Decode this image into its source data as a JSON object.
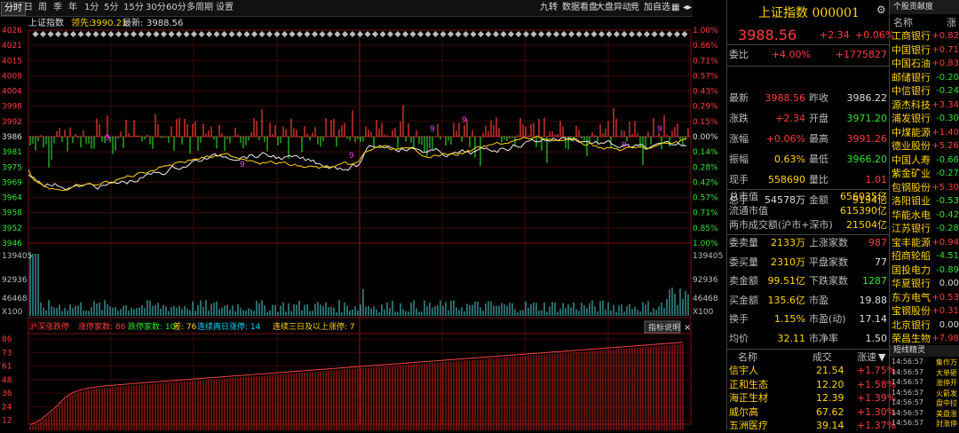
{
  "toolbar": {
    "tabs": [
      "分时",
      "日",
      "周",
      "季",
      "年",
      "1分",
      "5分",
      "15分",
      "30分",
      "60分",
      "多周期",
      "设置"
    ],
    "right_tabs": [
      "九转",
      "数据看盘",
      "大盘异动",
      "竞",
      "加自选"
    ]
  },
  "chart": {
    "index_name": "上证指数",
    "leading_label": "领先:",
    "leading_value": "3990.21",
    "latest_label": "最新:",
    "latest_value": "3988.56",
    "price_ticks": [
      "4026",
      "4021",
      "4015",
      "4009",
      "4004",
      "3998",
      "3992",
      "3986",
      "3981",
      "3975",
      "3969",
      "3964",
      "3958",
      "3952",
      "3946"
    ],
    "pct_ticks": [
      "1.00%",
      "0.86%",
      "0.71%",
      "0.57%",
      "0.43%",
      "0.29%",
      "0.15%",
      "0.00%",
      "0.14%",
      "0.28%",
      "0.42%",
      "0.57%",
      "0.71%",
      "0.85%",
      "1.00%"
    ],
    "vol_ticks": [
      "139405",
      "92936",
      "46468",
      "X100"
    ],
    "breadth_bar": {
      "a": "沪深涨跌停",
      "b": "涨停家数: 86",
      "c": "跌停家数: 10",
      "d": "差: 76",
      "e": "连续两日涨停: 14",
      "f": "连续三日及以上涨停: 7",
      "btn": "指标说明"
    },
    "breadth_ticks": [
      "86",
      "73",
      "61",
      "48",
      "36",
      "24",
      "12"
    ],
    "markers": [
      "9",
      "9",
      "9",
      "9",
      "9",
      "9",
      "9"
    ]
  },
  "panel": {
    "title": "上证指数 000001",
    "price": "3988.56",
    "change": "+2.34",
    "change_pct": "+0.06%",
    "webi_label": "委比",
    "webi_pct": "+4.00%",
    "webi_diff": "+1775827",
    "stats": [
      {
        "l1": "最新",
        "v1": "3988.56",
        "c1": "r",
        "l2": "昨收",
        "v2": "3986.22",
        "c2": "w"
      },
      {
        "l1": "涨跌",
        "v1": "+2.34",
        "c1": "r",
        "l2": "开盘",
        "v2": "3971.20",
        "c2": "g"
      },
      {
        "l1": "涨幅",
        "v1": "+0.06%",
        "c1": "r",
        "l2": "最高",
        "v2": "3991.26",
        "c2": "r"
      },
      {
        "l1": "振幅",
        "v1": "0.63%",
        "c1": "y",
        "l2": "最低",
        "v2": "3966.20",
        "c2": "g"
      },
      {
        "l1": "现手",
        "v1": "558690",
        "c1": "y",
        "l2": "量比",
        "v2": "1.01",
        "c2": "r"
      },
      {
        "l1": "总手",
        "v1": "54578万",
        "c1": "w",
        "l2": "金额",
        "v2": "9194亿",
        "c2": "y"
      }
    ],
    "market": [
      {
        "l": "总市值",
        "v": "656035亿"
      },
      {
        "l": "流通市值",
        "v": "615390亿"
      },
      {
        "l": "两市成交额(沪市+深市)",
        "v": "21504亿"
      }
    ],
    "stats2": [
      {
        "l1": "委卖量",
        "v1": "2133万",
        "c1": "y",
        "l2": "上涨家数",
        "v2": "987",
        "c2": "r"
      },
      {
        "l1": "委买量",
        "v1": "2310万",
        "c1": "y",
        "l2": "平盘家数",
        "v2": "77",
        "c2": "w"
      },
      {
        "l1": "卖金额",
        "v1": "99.51亿",
        "c1": "y",
        "l2": "下跌家数",
        "v2": "1287",
        "c2": "g"
      },
      {
        "l1": "买金额",
        "v1": "135.6亿",
        "c1": "y",
        "l2": "市盈",
        "v2": "19.88",
        "c2": "w"
      },
      {
        "l1": "换手",
        "v1": "1.15%",
        "c1": "y",
        "l2": "市盈(动)",
        "v2": "17.14",
        "c2": "w"
      },
      {
        "l1": "均价",
        "v1": "32.11",
        "c1": "y",
        "l2": "市净率",
        "v2": "1.50",
        "c2": "w"
      }
    ],
    "table_headers": [
      "名称",
      "成交",
      "涨速"
    ],
    "table": [
      {
        "name": "信宇人",
        "price": "21.54",
        "speed": "+1.75%"
      },
      {
        "name": "正和生态",
        "price": "12.20",
        "speed": "+1.58%"
      },
      {
        "name": "海正生材",
        "price": "12.39",
        "speed": "+1.39%"
      },
      {
        "name": "威尔高",
        "price": "67.62",
        "speed": "+1.30%"
      },
      {
        "name": "五洲医疗",
        "price": "39.14",
        "speed": "+1.37%"
      }
    ]
  },
  "side": {
    "header": "个股贡献度",
    "col1": "名称",
    "col2": "涨",
    "stocks": [
      {
        "n": "工商银行",
        "v": "+0.82",
        "c": "r"
      },
      {
        "n": "中国银行",
        "v": "+0.71",
        "c": "r"
      },
      {
        "n": "中国石油",
        "v": "+0.83",
        "c": "r"
      },
      {
        "n": "邮储银行",
        "v": "-0.20",
        "c": "g"
      },
      {
        "n": "中信银行",
        "v": "-0.24",
        "c": "g"
      },
      {
        "n": "源杰科技",
        "v": "+3.34",
        "c": "r"
      },
      {
        "n": "浦发银行",
        "v": "-0.30",
        "c": "g"
      },
      {
        "n": "中煤能源",
        "v": "+1.40",
        "c": "r"
      },
      {
        "n": "德业股份",
        "v": "+5.26",
        "c": "r"
      },
      {
        "n": "中国人寿",
        "v": "-0.66",
        "c": "g"
      },
      {
        "n": "紫金矿业",
        "v": "-0.27",
        "c": "g"
      },
      {
        "n": "包钢股份",
        "v": "+5.30",
        "c": "r"
      },
      {
        "n": "洛阳钼业",
        "v": "-0.53",
        "c": "g"
      },
      {
        "n": "华能水电",
        "v": "-0.42",
        "c": "g"
      },
      {
        "n": "江苏银行",
        "v": "-0.28",
        "c": "g"
      },
      {
        "n": "宝丰能源",
        "v": "+0.94",
        "c": "r"
      },
      {
        "n": "招商轮船",
        "v": "-4.51",
        "c": "g"
      },
      {
        "n": "国投电力",
        "v": "-0.89",
        "c": "g"
      },
      {
        "n": "华夏银行",
        "v": "0.00",
        "c": "w"
      },
      {
        "n": "东方电气",
        "v": "+0.53",
        "c": "r"
      },
      {
        "n": "宝钢股份",
        "v": "+0.31",
        "c": "r"
      },
      {
        "n": "北京银行",
        "v": "0.00",
        "c": "w"
      },
      {
        "n": "荣昌生物",
        "v": "+7.98",
        "c": "r"
      }
    ],
    "short_header": "短线精灵",
    "short_times": [
      "14:56:57",
      "14:56:57",
      "14:56:57",
      "14:56:57",
      "14:56:57",
      "14:56:57",
      "14:56:57"
    ],
    "short_labels": [
      "集作万",
      "大单砸",
      "涨停开",
      "火箭发",
      "盘中拉",
      "美盘涨",
      "封涨停"
    ]
  }
}
